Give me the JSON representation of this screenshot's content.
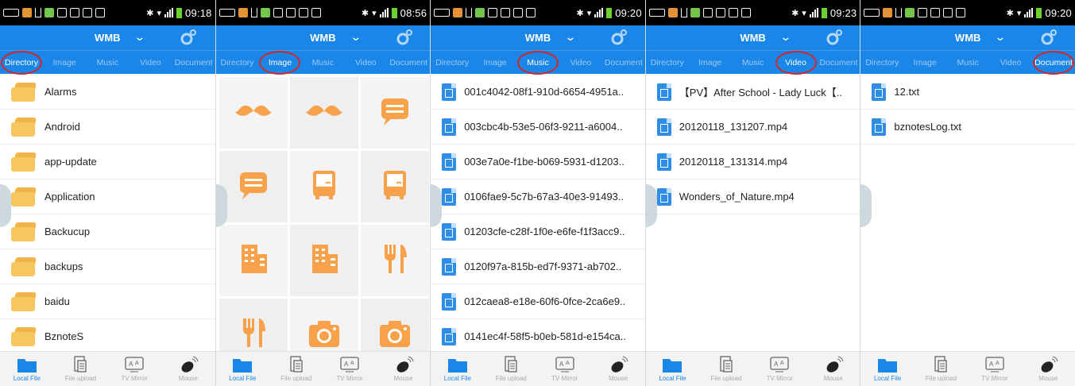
{
  "panels": [
    {
      "status_time": "09:18",
      "title": "WMB",
      "tabs": [
        "Directory",
        "Image",
        "Music",
        "Video",
        "Document"
      ],
      "active_tab": 0,
      "content_type": "folders",
      "items": [
        "Alarms",
        "Android",
        "app-update",
        "Application",
        "Backucup",
        "backups",
        "baidu",
        "BznoteS"
      ]
    },
    {
      "status_time": "08:56",
      "title": "WMB",
      "tabs": [
        "Directory",
        "Image",
        "Music",
        "Video",
        "Document"
      ],
      "active_tab": 1,
      "content_type": "image-grid",
      "grid_icons": [
        "mustache-icon",
        "mustache-icon",
        "chat-bubble-icon",
        "chat-bubble-icon",
        "bus-icon",
        "bus-icon",
        "building-icon",
        "building-icon",
        "fork-knife-icon",
        "fork-knife-icon",
        "camera-icon",
        "camera-icon"
      ]
    },
    {
      "status_time": "09:20",
      "title": "WMB",
      "tabs": [
        "Directory",
        "Image",
        "Music",
        "Video",
        "Document"
      ],
      "active_tab": 2,
      "content_type": "files",
      "items": [
        "001c4042-08f1-910d-6654-4951a..",
        "003cbc4b-53e5-06f3-9211-a6004..",
        "003e7a0e-f1be-b069-5931-d1203..",
        "0106fae9-5c7b-67a3-40e3-91493..",
        "01203cfe-c28f-1f0e-e6fe-f1f3acc9..",
        "0120f97a-815b-ed7f-9371-ab702..",
        "012caea8-e18e-60f6-0fce-2ca6e9..",
        "0141ec4f-58f5-b0eb-581d-e154ca.."
      ]
    },
    {
      "status_time": "09:23",
      "title": "WMB",
      "tabs": [
        "Directory",
        "Image",
        "Music",
        "Video",
        "Document"
      ],
      "active_tab": 3,
      "content_type": "files",
      "items": [
        "【PV】After School - Lady Luck【..",
        "20120118_131207.mp4",
        "20120118_131314.mp4",
        "Wonders_of_Nature.mp4"
      ]
    },
    {
      "status_time": "09:20",
      "title": "WMB",
      "tabs": [
        "Directory",
        "Image",
        "Music",
        "Video",
        "Document"
      ],
      "active_tab": 4,
      "content_type": "files",
      "items": [
        "12.txt",
        "bznotesLog.txt"
      ]
    }
  ],
  "bottom_nav": [
    "Local File",
    "File upload",
    "TV Mirror",
    "Mouse"
  ],
  "bottom_icons": [
    "folder-icon",
    "file-upload-icon",
    "tv-mirror-icon",
    "mouse-icon"
  ],
  "colors": {
    "accent": "#1a86e8",
    "highlight_circle": "#d1282b",
    "icon_orange": "#f7a14a",
    "folder": "#f6c65f"
  }
}
